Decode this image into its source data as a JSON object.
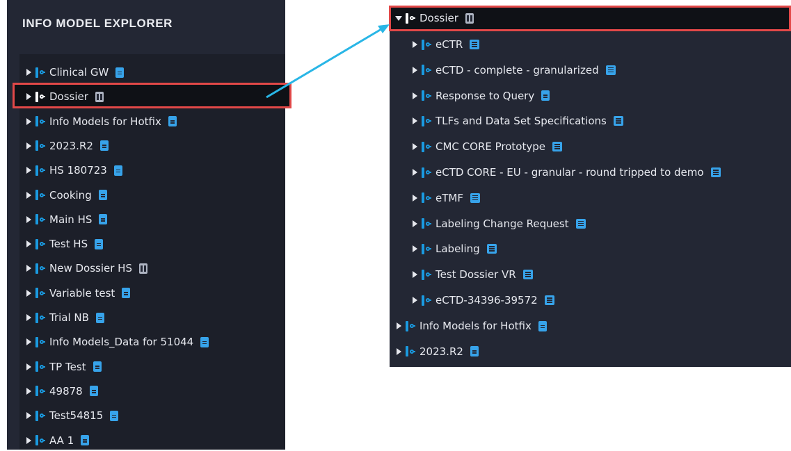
{
  "left": {
    "title": "INFO MODEL EXPLORER",
    "items": [
      {
        "label": "Clinical GW",
        "icon": "doc-icon"
      },
      {
        "label": "Dossier",
        "icon": "dossier-icon",
        "selected": true
      },
      {
        "label": "Info Models for Hotfix",
        "icon": "doc-icon"
      },
      {
        "label": "2023.R2",
        "icon": "doc-icon"
      },
      {
        "label": "HS 180723",
        "icon": "doc-icon"
      },
      {
        "label": "Cooking",
        "icon": "doc-icon"
      },
      {
        "label": "Main HS",
        "icon": "doc-icon"
      },
      {
        "label": "Test HS",
        "icon": "doc-icon"
      },
      {
        "label": "New Dossier HS",
        "icon": "dossier-icon"
      },
      {
        "label": "Variable test",
        "icon": "doc-icon"
      },
      {
        "label": "Trial NB",
        "icon": "doc-icon"
      },
      {
        "label": "Info Models_Data for 51044",
        "icon": "doc-icon"
      },
      {
        "label": "TP Test",
        "icon": "doc-icon"
      },
      {
        "label": "49878",
        "icon": "doc-icon"
      },
      {
        "label": "Test54815",
        "icon": "doc-icon"
      },
      {
        "label": "AA 1",
        "icon": "doc-icon"
      }
    ]
  },
  "right": {
    "root": {
      "label": "Dossier",
      "icon": "dossier-icon"
    },
    "children": [
      {
        "label": "eCTR",
        "icon": "list-icon"
      },
      {
        "label": "eCTD - complete - granularized",
        "icon": "list-icon"
      },
      {
        "label": "Response to Query",
        "icon": "doc-icon"
      },
      {
        "label": "TLFs and Data Set Specifications",
        "icon": "list-icon"
      },
      {
        "label": "CMC CORE Prototype",
        "icon": "list-icon"
      },
      {
        "label": "eCTD CORE - EU - granular - round tripped to demo",
        "icon": "list-icon"
      },
      {
        "label": "eTMF",
        "icon": "list-icon"
      },
      {
        "label": "Labeling Change Request",
        "icon": "list-icon"
      },
      {
        "label": "Labeling",
        "icon": "list-icon"
      },
      {
        "label": "Test Dossier VR",
        "icon": "list-icon"
      },
      {
        "label": "eCTD-34396-39572",
        "icon": "list-icon"
      }
    ],
    "siblings": [
      {
        "label": "Info Models for Hotfix",
        "icon": "doc-icon"
      },
      {
        "label": "2023.R2",
        "icon": "doc-icon"
      }
    ]
  },
  "colors": {
    "accent": "#1a9ae0",
    "highlight_border": "#e24848",
    "connector": "#29b6e6",
    "panel_bg": "#232734"
  }
}
